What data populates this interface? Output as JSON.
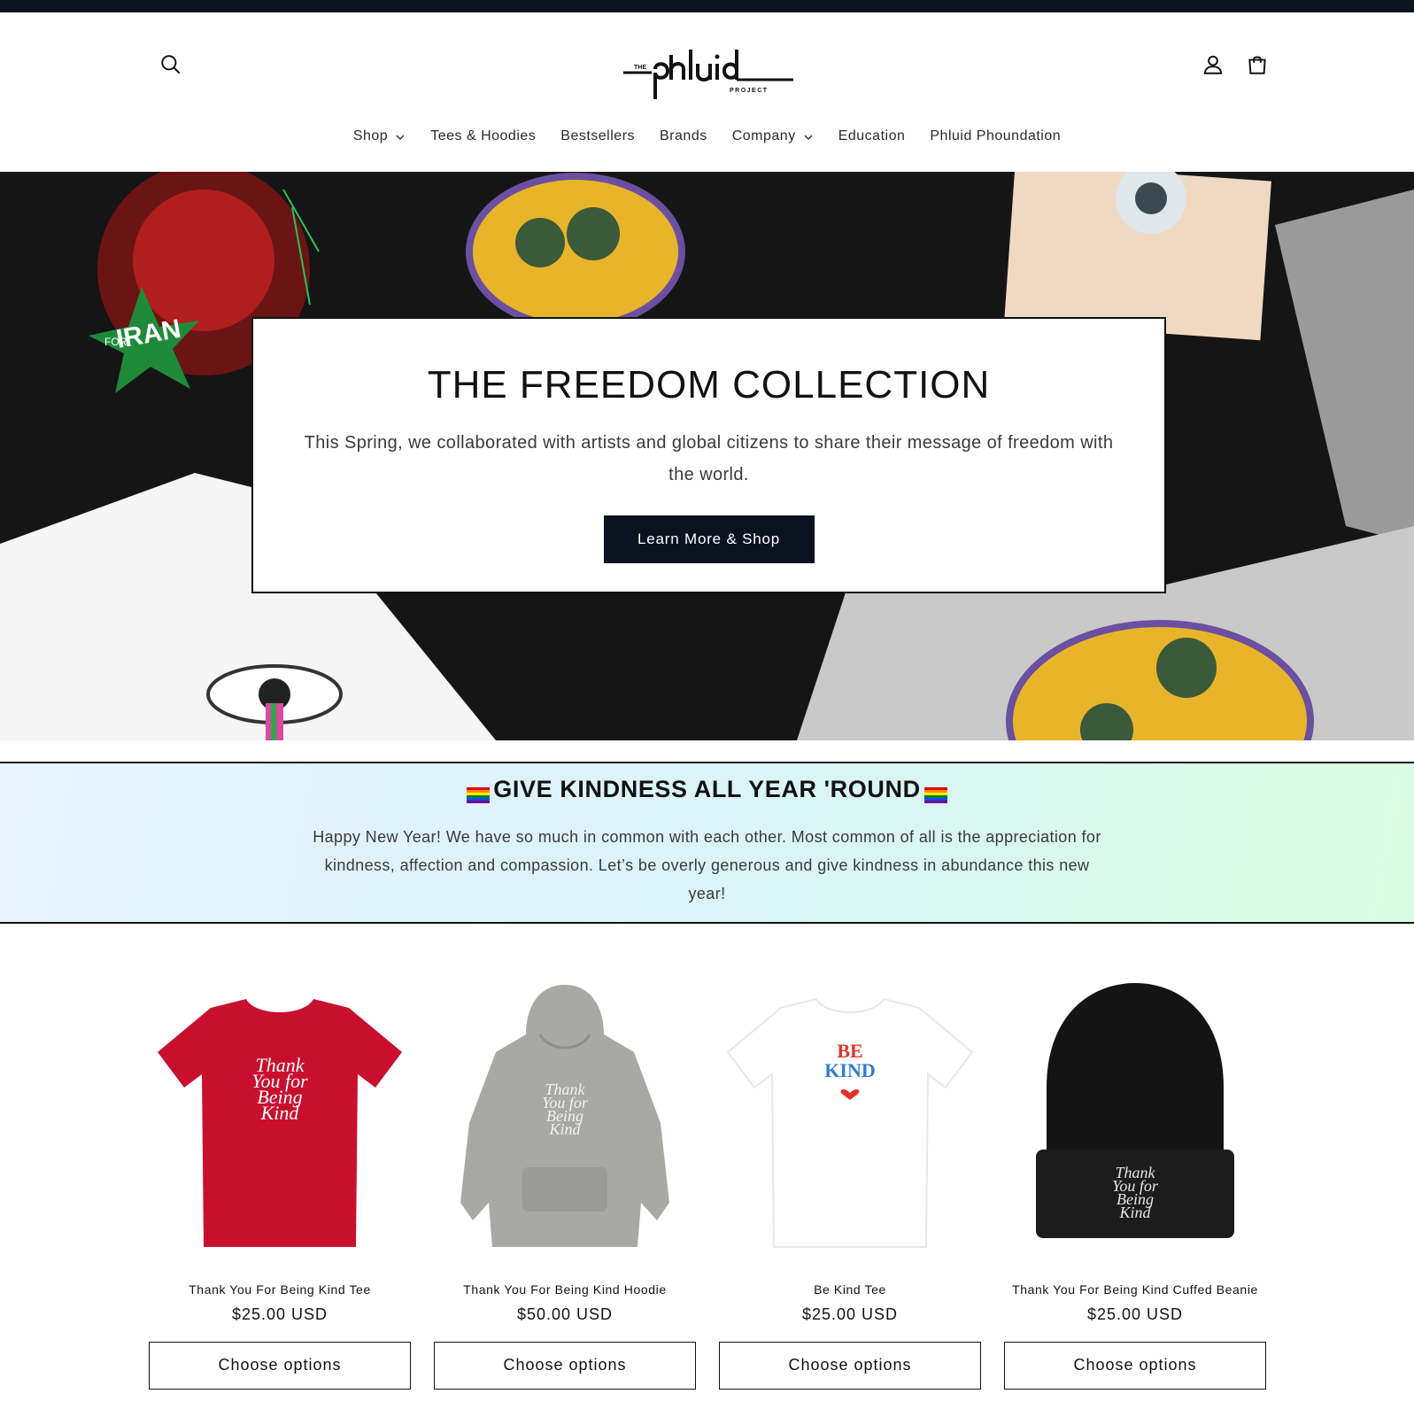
{
  "header": {
    "logo_text": "the phluid project",
    "icons": {
      "search": "search-icon",
      "account": "user-icon",
      "cart": "cart-icon"
    }
  },
  "nav": [
    {
      "label": "Shop",
      "has_dropdown": true
    },
    {
      "label": "Tees & Hoodies",
      "has_dropdown": false
    },
    {
      "label": "Bestsellers",
      "has_dropdown": false
    },
    {
      "label": "Brands",
      "has_dropdown": false
    },
    {
      "label": "Company",
      "has_dropdown": true
    },
    {
      "label": "Education",
      "has_dropdown": false
    },
    {
      "label": "Phluid Phoundation",
      "has_dropdown": false
    }
  ],
  "hero": {
    "title": "THE FREEDOM COLLECTION",
    "text": "This Spring, we collaborated with artists and global citizens to share their message of freedom with the world.",
    "button": "Learn More & Shop",
    "artwork_text": [
      "FOR",
      "IRAN"
    ]
  },
  "kindness": {
    "title": "GIVE KINDNESS ALL YEAR 'ROUND",
    "text": "Happy New Year! We have so much in common with each other. Most common of all is the appreciation for kindness, affection and compassion. Let’s be overly generous and give kindness in abundance this new year!"
  },
  "products": [
    {
      "name": "Thank You For Being Kind Tee",
      "price": "$25.00 USD",
      "button": "Choose options",
      "color": "#c8102e"
    },
    {
      "name": "Thank You For Being Kind Hoodie",
      "price": "$50.00 USD",
      "button": "Choose options",
      "color": "#a8a8a4"
    },
    {
      "name": "Be Kind Tee",
      "price": "$25.00 USD",
      "button": "Choose options",
      "color": "#ffffff"
    },
    {
      "name": "Thank You For Being Kind Cuffed Beanie",
      "price": "$25.00 USD",
      "button": "Choose options",
      "color": "#111111"
    }
  ],
  "product_print": {
    "lines": [
      "Thank",
      "You for",
      "Being",
      "Kind"
    ],
    "be_kind": [
      "BE",
      "KIND"
    ]
  },
  "colors": {
    "dark": "#0b1220",
    "accent_red": "#c8102e"
  }
}
